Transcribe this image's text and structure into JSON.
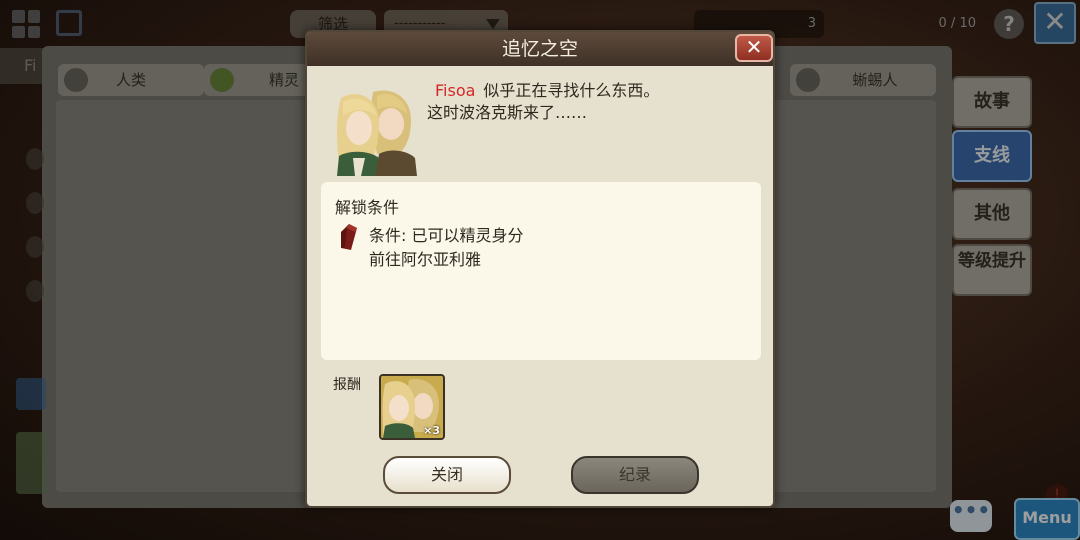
{
  "background": {
    "filter_button": "筛选",
    "sort_select_value": "-----------",
    "count_a": "3",
    "count_b": "0 / 10",
    "help_label": "?",
    "left_tab_label": "Fi",
    "category_tabs": [
      {
        "label": "人类"
      },
      {
        "label": "精灵"
      },
      {
        "label": "蜥蜴人"
      }
    ],
    "right_tabs": [
      {
        "label": "故事"
      },
      {
        "label": "支线"
      },
      {
        "label": "其他"
      },
      {
        "label": "等级提升"
      }
    ],
    "menu_label": "Menu",
    "chat_label": "•••",
    "alert_label": "!"
  },
  "dialog": {
    "title": "追忆之空",
    "close_icon_label": "✕",
    "story_name": "Fisoa",
    "story_line1_rest": "似乎正在寻找什么东西。",
    "story_line2": "这时波洛克斯来了……",
    "condition_title": "解锁条件",
    "condition_line1": "条件:  已可以精灵身分",
    "condition_line2": "前往阿尔亚利雅",
    "reward_label": "报酬",
    "reward_quantity": "×3",
    "button_close": "关闭",
    "button_record": "纪录"
  },
  "colors": {
    "dialog_bg": "#e6e1cf",
    "header_bg": "#4a3a2e",
    "name_red": "#d3282a",
    "active_tab_blue": "#3e6fb0"
  }
}
